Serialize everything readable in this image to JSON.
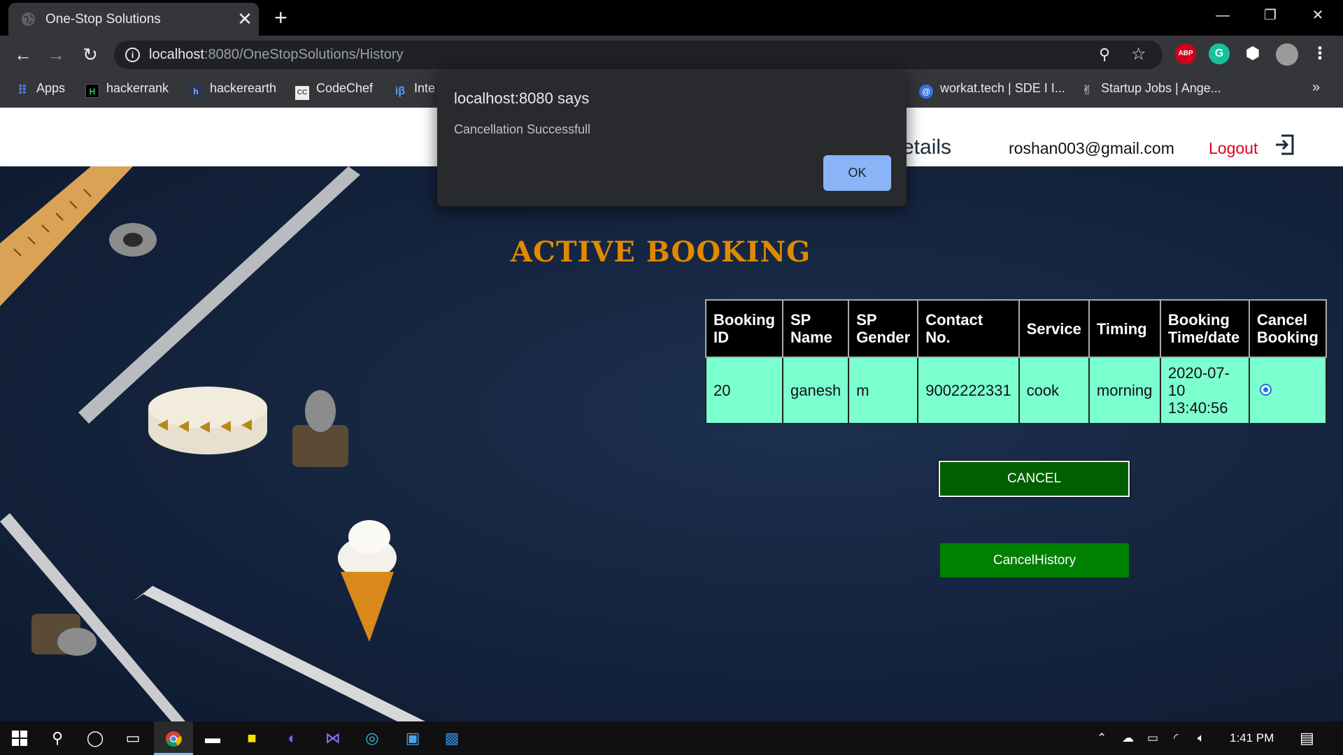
{
  "browser": {
    "tab_title": "One-Stop Solutions",
    "tab_close": "✕",
    "new_tab": "+",
    "url_host": "localhost",
    "url_rest": ":8080/OneStopSolutions/History",
    "window_controls": {
      "minimize": "—",
      "restore": "❐",
      "close": "✕"
    },
    "extensions": [
      "ABP",
      "G"
    ],
    "bookmarks": [
      {
        "label": "Apps",
        "icon": "apps-grid-icon"
      },
      {
        "label": "hackerrank",
        "icon": "hackerrank-icon"
      },
      {
        "label": "hackerearth",
        "icon": "hackerearth-icon"
      },
      {
        "label": "CodeChef",
        "icon": "codechef-icon"
      },
      {
        "label": "Inte",
        "icon": "interviewbit-icon"
      },
      {
        "label": "workat.tech | SDE I I...",
        "icon": "workat-icon"
      },
      {
        "label": "Startup Jobs | Ange...",
        "icon": "angellist-icon"
      }
    ],
    "bookmarks_overflow": "»"
  },
  "header": {
    "user_details": "r Details",
    "email": "roshan003@gmail.com",
    "logout": "Logout"
  },
  "main": {
    "heading": "ACTIVE BOOKING",
    "table": {
      "columns": [
        [
          "Booking",
          "ID"
        ],
        [
          "SP",
          "Name"
        ],
        [
          "SP",
          "Gender"
        ],
        [
          "Contact",
          "No."
        ],
        [
          "Service"
        ],
        [
          "Timing"
        ],
        [
          "Booking",
          "Time/date"
        ],
        [
          "Cancel",
          "Booking"
        ]
      ],
      "rows": [
        {
          "booking_id": "20",
          "sp_name": "ganesh",
          "sp_gender": "m",
          "contact": "9002222331",
          "service": "cook",
          "timing": "morning",
          "booking_time": [
            "2020-07-",
            "10",
            "13:40:56"
          ],
          "selected": true
        }
      ]
    },
    "cancel_button": "CANCEL",
    "cancel_history_button": "CancelHistory"
  },
  "alert": {
    "title": "localhost:8080 says",
    "message": "Cancellation Successfull",
    "ok": "OK"
  },
  "taskbar": {
    "time": "1:41 PM"
  },
  "colors": {
    "heading": "#e08a00",
    "row_bg": "#7cffcf",
    "cancel_btn": "#005f00",
    "cancel_history_btn": "#008000",
    "logout": "#e0001b",
    "alert_ok": "#8ab4f8"
  }
}
